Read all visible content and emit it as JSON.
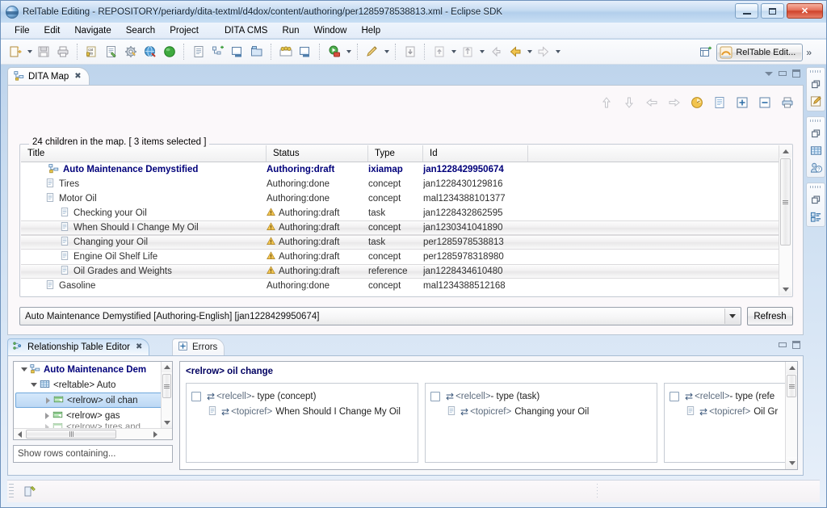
{
  "window": {
    "title": "RelTable Editing - REPOSITORY/periardy/dita-textml/d4dox/content/authoring/per1285978538813.xml - Eclipse SDK",
    "app_icon": "eclipse-globe-icon",
    "buttons": {
      "minimize": "minimize-button",
      "maximize": "maximize-button",
      "close": "✕"
    }
  },
  "menubar": {
    "items": [
      "File",
      "Edit",
      "Navigate",
      "Search",
      "Project",
      "DITA CMS",
      "Run",
      "Window",
      "Help"
    ]
  },
  "toolbar": {
    "groups": [
      {
        "buttons": [
          {
            "name": "new-wizard-icon",
            "dropdown": true
          },
          {
            "name": "save-icon",
            "dropdown": false
          },
          {
            "name": "print-icon",
            "dropdown": false
          }
        ]
      },
      {
        "buttons": [
          {
            "name": "validate-icon",
            "dropdown": false
          },
          {
            "name": "new-topic-icon",
            "dropdown": false
          },
          {
            "name": "settings-gear-icon",
            "dropdown": false
          },
          {
            "name": "globe-publish-icon",
            "dropdown": false
          },
          {
            "name": "green-sphere-icon",
            "dropdown": false
          }
        ]
      },
      {
        "buttons": [
          {
            "name": "open-document-icon",
            "dropdown": false
          },
          {
            "name": "new-map-icon",
            "dropdown": false
          },
          {
            "name": "open-editor-icon",
            "dropdown": false
          },
          {
            "name": "new-folder-icon",
            "dropdown": false
          }
        ]
      },
      {
        "buttons": [
          {
            "name": "users-group-icon",
            "dropdown": false
          },
          {
            "name": "display-icon",
            "dropdown": false
          }
        ]
      },
      {
        "buttons": [
          {
            "name": "run-icon",
            "dropdown": true
          }
        ]
      },
      {
        "buttons": [
          {
            "name": "debug-pencil-icon",
            "dropdown": true
          }
        ]
      },
      {
        "buttons": [
          {
            "name": "checkin-icon",
            "dropdown": false
          }
        ]
      },
      {
        "buttons": [
          {
            "name": "checkout-icon",
            "dropdown": true
          },
          {
            "name": "upload-icon",
            "dropdown": true
          }
        ]
      },
      {
        "buttons": [
          {
            "name": "back-small-icon",
            "dropdown": false
          },
          {
            "name": "back-icon",
            "dropdown": true
          },
          {
            "name": "forward-icon",
            "dropdown": true
          }
        ]
      }
    ]
  },
  "perspective": {
    "new_perspective_icon": "new-perspective-icon",
    "active_label": "RelTable Edit...",
    "active_icon": "reltable-perspective-icon",
    "more": "»"
  },
  "editor": {
    "tab": {
      "label": "DITA Map",
      "icon": "dita-map-icon",
      "close": "✖"
    },
    "view_controls": [
      "view-menu-icon",
      "minimize-icon",
      "maximize-icon"
    ],
    "map_toolbar": [
      "move-up-icon",
      "move-down-icon",
      "promote-left-icon",
      "demote-right-icon",
      "clock-status-icon",
      "new-topic-icon",
      "expand-all-icon",
      "collapse-all-icon",
      "print-map-icon"
    ],
    "group_label": "24 children in the map. [ 3 items selected ]",
    "table": {
      "columns": [
        "Title",
        "Status",
        "Type",
        "Id"
      ],
      "rows": [
        {
          "title": "Auto Maintenance Demystified",
          "status": "Authoring:draft",
          "type": "ixiamap",
          "id": "jan1228429950674",
          "indent": 0,
          "icon": "map-locked-icon",
          "warn": false,
          "selected": false,
          "root": true
        },
        {
          "title": "Tires",
          "status": "Authoring:done",
          "type": "concept",
          "id": "jan1228430129816",
          "indent": 1,
          "icon": "topic-icon",
          "warn": false,
          "selected": false,
          "root": false
        },
        {
          "title": "Motor Oil",
          "status": "Authoring:done",
          "type": "concept",
          "id": "mal1234388101377",
          "indent": 1,
          "icon": "topic-icon",
          "warn": false,
          "selected": false,
          "root": false
        },
        {
          "title": "Checking your Oil",
          "status": "Authoring:draft",
          "type": "task",
          "id": "jan1228432862595",
          "indent": 2,
          "icon": "topic-icon",
          "warn": true,
          "selected": false,
          "root": false
        },
        {
          "title": "When Should I Change My Oil",
          "status": "Authoring:draft",
          "type": "concept",
          "id": "jan1230341041890",
          "indent": 2,
          "icon": "topic-icon",
          "warn": true,
          "selected": true,
          "root": false
        },
        {
          "title": "Changing your Oil",
          "status": "Authoring:draft",
          "type": "task",
          "id": "per1285978538813",
          "indent": 2,
          "icon": "topic-icon",
          "warn": true,
          "selected": true,
          "root": false
        },
        {
          "title": "Engine Oil Shelf Life",
          "status": "Authoring:draft",
          "type": "concept",
          "id": "per1285978318980",
          "indent": 2,
          "icon": "topic-icon",
          "warn": true,
          "selected": false,
          "root": false
        },
        {
          "title": "Oil Grades and Weights",
          "status": "Authoring:draft",
          "type": "reference",
          "id": "jan1228434610480",
          "indent": 2,
          "icon": "topic-icon",
          "warn": true,
          "selected": true,
          "root": false
        },
        {
          "title": "Gasoline",
          "status": "Authoring:done",
          "type": "concept",
          "id": "mal1234388512168",
          "indent": 1,
          "icon": "topic-icon",
          "warn": false,
          "selected": false,
          "root": false
        }
      ]
    },
    "combo": {
      "value": "Auto Maintenance Demystified [Authoring-English] [jan1228429950674]"
    },
    "refresh_label": "Refresh"
  },
  "bottom_view": {
    "tabs": [
      {
        "label": "Relationship Table Editor",
        "icon": "reltable-icon",
        "active": true,
        "close": "✖"
      },
      {
        "label": "Errors",
        "icon": "errors-icon",
        "active": false
      }
    ],
    "view_controls": [
      "minimize-icon",
      "maximize-icon"
    ],
    "tree": [
      {
        "label": "Auto Maintenance Dem",
        "indent": 0,
        "twisty": "open",
        "icon": "map-locked-icon",
        "selected": false,
        "root": true
      },
      {
        "label": "<reltable> Auto",
        "indent": 1,
        "twisty": "open",
        "icon": "reltable-grid-icon",
        "selected": false,
        "root": false
      },
      {
        "label": "<relrow> oil chan",
        "indent": 2,
        "twisty": "closed",
        "icon": "relrow-icon",
        "selected": true,
        "root": false
      },
      {
        "label": "<relrow> gas",
        "indent": 2,
        "twisty": "closed",
        "icon": "relrow-icon",
        "selected": false,
        "root": false
      },
      {
        "label": "<relrow> tires and",
        "indent": 2,
        "twisty": "closed",
        "icon": "relrow-icon",
        "selected": false,
        "root": false
      }
    ],
    "filter_placeholder": "Show rows containing...",
    "relrow_title": "<relrow> oil change",
    "cells": [
      {
        "header_tag": "<relcell>",
        "header_suffix": " - type (concept)",
        "topic_tag": "<topicref>",
        "topic_title": "When Should I Change My Oil",
        "checked": false
      },
      {
        "header_tag": "<relcell>",
        "header_suffix": " - type (task)",
        "topic_tag": "<topicref>",
        "topic_title": "Changing your Oil",
        "checked": false
      },
      {
        "header_tag": "<relcell>",
        "header_suffix": " - type (refe",
        "topic_tag": "<topicref>",
        "topic_title": "Oil Gr",
        "checked": false
      }
    ]
  },
  "fastbar": {
    "groups": [
      {
        "items": [
          "restore-icon",
          "editor-pencil-icon"
        ]
      },
      {
        "items": [
          "restore-icon",
          "dita-map-grid-icon",
          "user-help-icon"
        ]
      },
      {
        "items": [
          "restore-icon",
          "outline-list-icon"
        ]
      }
    ]
  },
  "statusbar": {
    "icon": "status-resource-icon",
    "text": ""
  },
  "colors": {
    "title_bar": "#b3cfec",
    "accent_blue": "#00007a",
    "selection": "#bcd8f4",
    "warn_yellow": "#f0b429",
    "close_red": "#cf432c"
  }
}
